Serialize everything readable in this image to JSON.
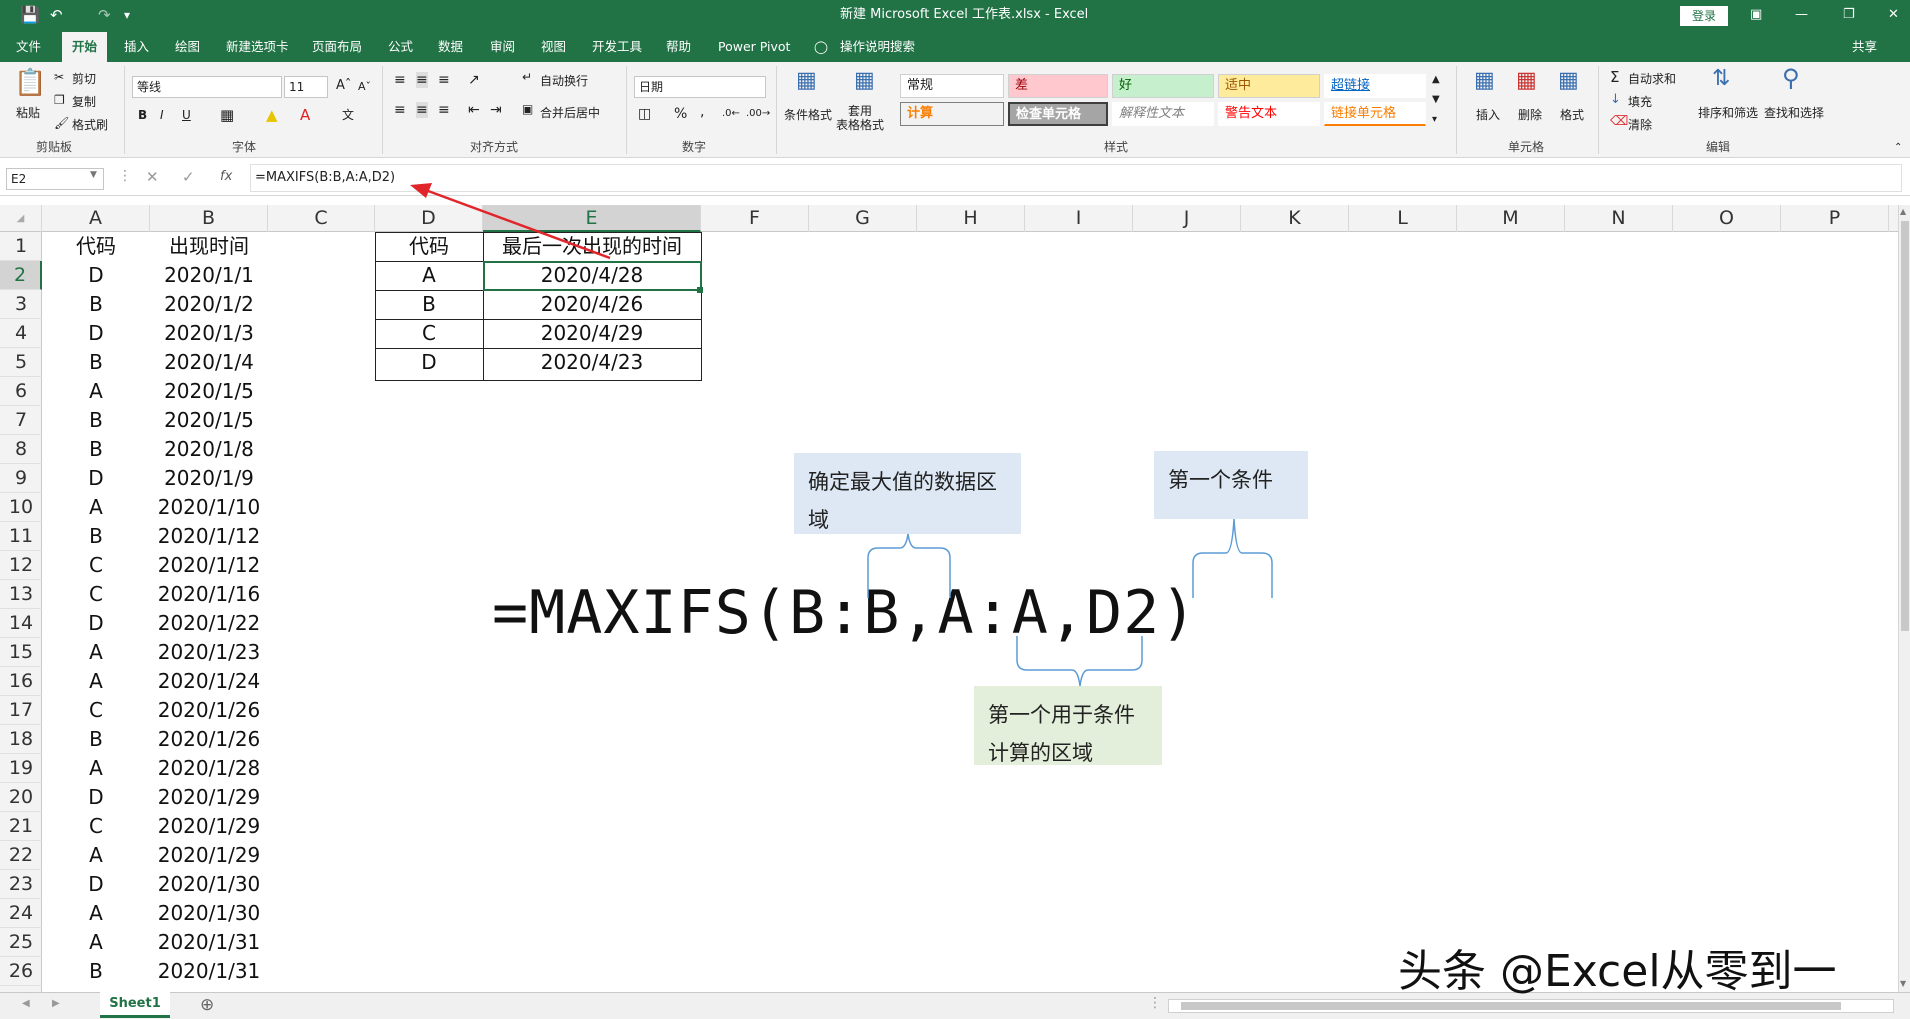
{
  "titlebar": {
    "title": "新建 Microsoft Excel 工作表.xlsx  -  Excel",
    "login_label": "登录"
  },
  "tabs": [
    "文件",
    "开始",
    "插入",
    "绘图",
    "新建选项卡",
    "页面布局",
    "公式",
    "数据",
    "审阅",
    "视图",
    "开发工具",
    "帮助",
    "Power Pivot",
    "操作说明搜索"
  ],
  "active_tab": "开始",
  "share_label": "共享",
  "ribbon": {
    "clipboard": {
      "paste": "粘贴",
      "cut": "剪切",
      "copy": "复制",
      "format_painter": "格式刷",
      "group": "剪贴板"
    },
    "font": {
      "name": "等线",
      "size": "11",
      "bold": "B",
      "italic": "I",
      "underline": "U",
      "group": "字体"
    },
    "align": {
      "wrap": "自动换行",
      "merge": "合并后居中",
      "group": "对齐方式"
    },
    "number": {
      "format": "日期",
      "percent": "%",
      "comma": ",",
      "group": "数字"
    },
    "styles": {
      "cond_format": "条件格式",
      "table_format": "套用\n表格格式",
      "normal": "常规",
      "bad": "差",
      "good": "好",
      "neutral": "适中",
      "hyperlink": "超链接",
      "calc": "计算",
      "check": "检查单元格",
      "explain": "解释性文本",
      "warn": "警告文本",
      "linked": "链接单元格",
      "group": "样式"
    },
    "cells": {
      "insert": "插入",
      "delete": "删除",
      "format": "格式",
      "group": "单元格"
    },
    "editing": {
      "autosum": "自动求和",
      "fill": "填充",
      "clear": "清除",
      "sort": "排序和筛选",
      "find": "查找和选择",
      "group": "编辑"
    }
  },
  "formula_bar": {
    "name_box": "E2",
    "fx": "fx",
    "formula": "=MAXIFS(B:B,A:A,D2)"
  },
  "columns": [
    "A",
    "B",
    "C",
    "D",
    "E",
    "F",
    "G",
    "H",
    "I",
    "J",
    "K",
    "L",
    "M",
    "N",
    "O",
    "P"
  ],
  "rows": [
    "1",
    "2",
    "3",
    "4",
    "5",
    "6",
    "7",
    "8",
    "9",
    "10",
    "11",
    "12",
    "13",
    "14",
    "15",
    "16",
    "17",
    "18",
    "19",
    "20",
    "21",
    "22",
    "23",
    "24",
    "25",
    "26"
  ],
  "sheet": {
    "header": {
      "a": "代码",
      "b": "出现时间"
    },
    "data": [
      [
        "D",
        "2020/1/1"
      ],
      [
        "B",
        "2020/1/2"
      ],
      [
        "D",
        "2020/1/3"
      ],
      [
        "B",
        "2020/1/4"
      ],
      [
        "A",
        "2020/1/5"
      ],
      [
        "B",
        "2020/1/5"
      ],
      [
        "B",
        "2020/1/8"
      ],
      [
        "D",
        "2020/1/9"
      ],
      [
        "A",
        "2020/1/10"
      ],
      [
        "B",
        "2020/1/12"
      ],
      [
        "C",
        "2020/1/12"
      ],
      [
        "C",
        "2020/1/16"
      ],
      [
        "D",
        "2020/1/22"
      ],
      [
        "A",
        "2020/1/23"
      ],
      [
        "A",
        "2020/1/24"
      ],
      [
        "C",
        "2020/1/26"
      ],
      [
        "B",
        "2020/1/26"
      ],
      [
        "A",
        "2020/1/28"
      ],
      [
        "D",
        "2020/1/29"
      ],
      [
        "C",
        "2020/1/29"
      ],
      [
        "A",
        "2020/1/29"
      ],
      [
        "D",
        "2020/1/30"
      ],
      [
        "A",
        "2020/1/30"
      ],
      [
        "A",
        "2020/1/31"
      ],
      [
        "B",
        "2020/1/31"
      ]
    ],
    "lookup_header": {
      "d": "代码",
      "e": "最后一次出现的时间"
    },
    "lookup": [
      [
        "A",
        "2020/4/28"
      ],
      [
        "B",
        "2020/4/26"
      ],
      [
        "C",
        "2020/4/29"
      ],
      [
        "D",
        "2020/4/23"
      ]
    ]
  },
  "annotations": {
    "max_range": "确定最大值的数据区域",
    "criteria_range": "第一个用于条件计算的区域",
    "criteria": "第一个条件",
    "formula_large": "=MAXIFS(B:B,A:A,D2)"
  },
  "colors": {
    "excel_green": "#217346",
    "note_blue": "#dde8f4",
    "note_green": "#e3efda",
    "arrow": "#e0252b"
  },
  "sheet_tab": "Sheet1",
  "watermark": "头条 @Excel从零到一"
}
